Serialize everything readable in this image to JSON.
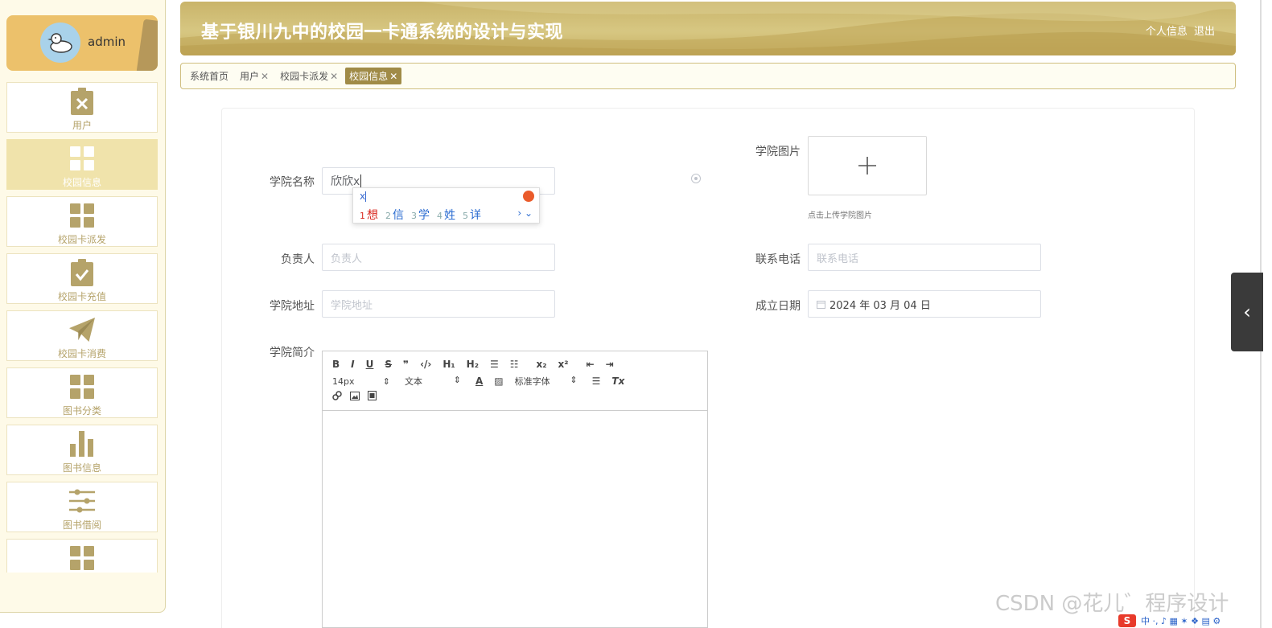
{
  "user": {
    "name": "admin"
  },
  "sidebar": {
    "items": [
      {
        "label": "用户",
        "icon": "clipboard-x-icon",
        "active": false
      },
      {
        "label": "校园信息",
        "icon": "grid-icon",
        "active": true
      },
      {
        "label": "校园卡派发",
        "icon": "grid-icon",
        "active": false
      },
      {
        "label": "校园卡充值",
        "icon": "clipboard-check-icon",
        "active": false
      },
      {
        "label": "校园卡消费",
        "icon": "paper-plane-icon",
        "active": false
      },
      {
        "label": "图书分类",
        "icon": "grid-icon",
        "active": false
      },
      {
        "label": "图书信息",
        "icon": "bar-chart-icon",
        "active": false
      },
      {
        "label": "图书借阅",
        "icon": "sliders-icon",
        "active": false
      },
      {
        "label": "",
        "icon": "grid-icon",
        "active": false
      }
    ]
  },
  "header": {
    "title": "基于银川九中的校园一卡通系统的设计与实现",
    "profile_link": "个人信息",
    "logout_link": "退出"
  },
  "tabs": [
    {
      "label": "系统首页",
      "closable": false,
      "active": false
    },
    {
      "label": "用户",
      "closable": true,
      "active": false
    },
    {
      "label": "校园卡派发",
      "closable": true,
      "active": false
    },
    {
      "label": "校园信息",
      "closable": true,
      "active": true
    }
  ],
  "tab_close_glyph": "✕",
  "form": {
    "college_name": {
      "label": "学院名称",
      "value": "欣欣x"
    },
    "college_image": {
      "label": "学院图片",
      "tip": "点击上传学院图片"
    },
    "manager": {
      "label": "负责人",
      "placeholder": "负责人",
      "value": ""
    },
    "phone": {
      "label": "联系电话",
      "placeholder": "联系电话",
      "value": ""
    },
    "address": {
      "label": "学院地址",
      "placeholder": "学院地址",
      "value": ""
    },
    "founded": {
      "label": "成立日期",
      "value": "2024 年 03 月 04 日"
    },
    "intro": {
      "label": "学院简介"
    }
  },
  "editor": {
    "row1": [
      "B",
      "I",
      "U",
      "S",
      "❞",
      "‹/›",
      "H₁",
      "H₂",
      "☰",
      "☷",
      "x₂",
      "x²",
      "⇤",
      "⇥"
    ],
    "font_size": "14px",
    "text_type": "文本",
    "font_family": "标准字体",
    "align_glyph": "☰",
    "clear_glyph": "Tx"
  },
  "ime": {
    "composition": "x",
    "candidates": [
      {
        "n": "1",
        "text": "想"
      },
      {
        "n": "2",
        "text": "信"
      },
      {
        "n": "3",
        "text": "学"
      },
      {
        "n": "4",
        "text": "姓"
      },
      {
        "n": "5",
        "text": "详"
      }
    ],
    "nav": "› ⌄"
  },
  "watermark": "CSDN @花儿゛程序设计",
  "tray": {
    "logo": "S",
    "text": "中 ·, ♪ ▦ ✶ ❖ ▤ ⚙"
  },
  "colors": {
    "accent": "#a08b47",
    "header": "#c9b46a",
    "sidebar_bg": "#fefae8",
    "menu_text": "#b5a36a"
  }
}
